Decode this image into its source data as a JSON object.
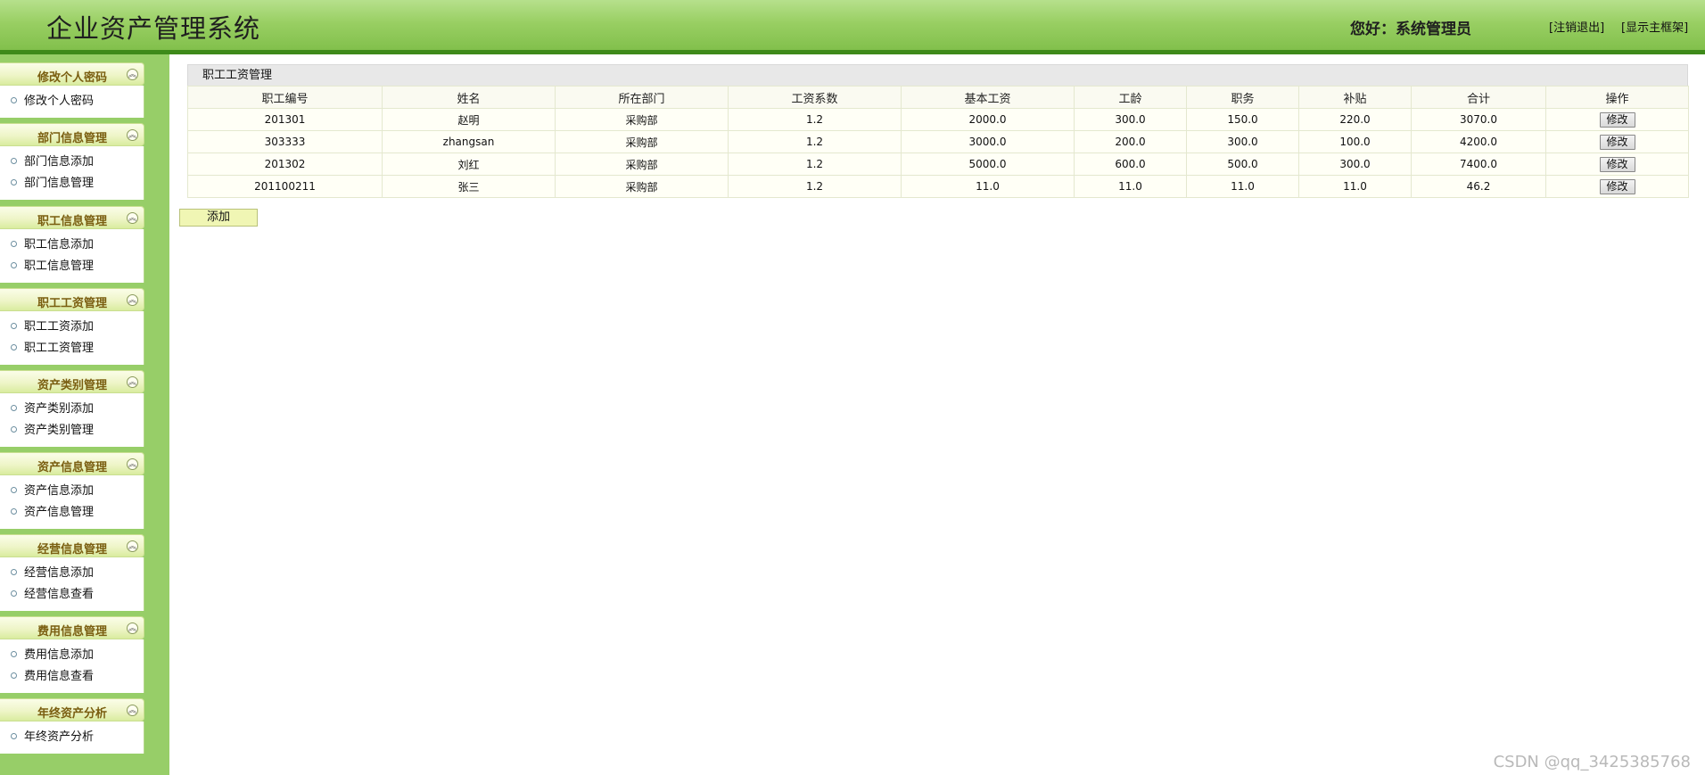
{
  "header": {
    "title": "企业资产管理系统",
    "greeting": "您好：系统管理员",
    "logout_label": "[注销退出]",
    "frame_label": "[显示主框架]"
  },
  "sidebar": {
    "groups": [
      {
        "title": "修改个人密码",
        "items": [
          "修改个人密码"
        ]
      },
      {
        "title": "部门信息管理",
        "items": [
          "部门信息添加",
          "部门信息管理"
        ]
      },
      {
        "title": "职工信息管理",
        "items": [
          "职工信息添加",
          "职工信息管理"
        ]
      },
      {
        "title": "职工工资管理",
        "items": [
          "职工工资添加",
          "职工工资管理"
        ]
      },
      {
        "title": "资产类别管理",
        "items": [
          "资产类别添加",
          "资产类别管理"
        ]
      },
      {
        "title": "资产信息管理",
        "items": [
          "资产信息添加",
          "资产信息管理"
        ]
      },
      {
        "title": "经营信息管理",
        "items": [
          "经营信息添加",
          "经营信息查看"
        ]
      },
      {
        "title": "费用信息管理",
        "items": [
          "费用信息添加",
          "费用信息查看"
        ]
      },
      {
        "title": "年终资产分析",
        "items": [
          "年终资产分析"
        ]
      }
    ]
  },
  "main": {
    "panel_title": "职工工资管理",
    "columns": [
      "职工编号",
      "姓名",
      "所在部门",
      "工资系数",
      "基本工资",
      "工龄",
      "职务",
      "补贴",
      "合计",
      "操作"
    ],
    "rows": [
      [
        "201301",
        "赵明",
        "采购部",
        "1.2",
        "2000.0",
        "300.0",
        "150.0",
        "220.0",
        "3070.0",
        "修改"
      ],
      [
        "303333",
        "zhangsan",
        "采购部",
        "1.2",
        "3000.0",
        "200.0",
        "300.0",
        "100.0",
        "4200.0",
        "修改"
      ],
      [
        "201302",
        "刘红",
        "采购部",
        "1.2",
        "5000.0",
        "600.0",
        "500.0",
        "300.0",
        "7400.0",
        "修改"
      ],
      [
        "201100211",
        "张三",
        "采购部",
        "1.2",
        "11.0",
        "11.0",
        "11.0",
        "11.0",
        "46.2",
        "修改"
      ]
    ],
    "add_label": "添加"
  },
  "watermark": "CSDN @qq_3425385768",
  "icons": {
    "collapse": "double-chevron-up-icon",
    "bullet": "circle-bullet-icon"
  },
  "colors": {
    "header_green": "#99cf63",
    "header_border": "#3e8a1a",
    "sidebar_green": "#97ce68",
    "group_title": "#7a5e10",
    "add_button": "#f0f6b4"
  }
}
